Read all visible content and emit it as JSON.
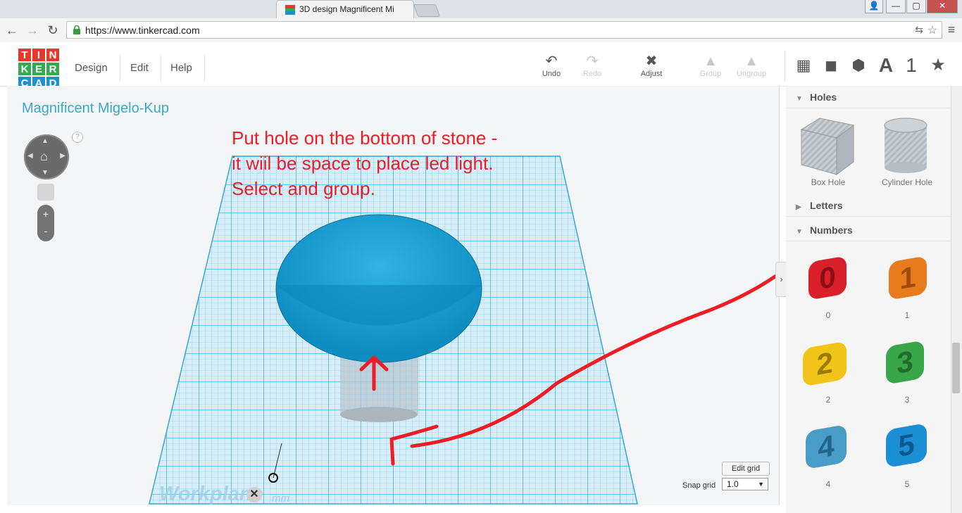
{
  "browser": {
    "tab_title": "3D design Magnificent Mi",
    "url": "https://www.tinkercad.com",
    "window_controls": {
      "user": "👤",
      "minimize": "—",
      "maximize": "▢",
      "close": "✕"
    }
  },
  "app": {
    "logo_letters": [
      "T",
      "I",
      "N",
      "K",
      "E",
      "R",
      "C",
      "A",
      "D"
    ],
    "logo_colors": [
      "#e8382e",
      "#e8382e",
      "#e8382e",
      "#35a853",
      "#35a853",
      "#35a853",
      "#1e8fcf",
      "#1e8fcf",
      "#1e8fcf"
    ],
    "menu": [
      "Design",
      "Edit",
      "Help"
    ],
    "tools": {
      "undo": "Undo",
      "redo": "Redo",
      "adjust": "Adjust",
      "group": "Group",
      "ungroup": "Ungroup"
    },
    "side_tools": {
      "letters_tab": "A",
      "numbers_tab": "1",
      "favorites_tab": "★"
    }
  },
  "canvas": {
    "design_title": "Magnificent Migelo-Kup",
    "help_mark": "?",
    "zoom_in": "+",
    "zoom_out": "-",
    "annotation": "Put hole on the bottom of stone -\nit wiil be space to place led light.\nSelect and group.",
    "edit_grid": "Edit grid",
    "snap_grid_label": "Snap grid",
    "snap_grid_value": "1.0",
    "workplane_label": "Workplane",
    "unit_label": "mm",
    "accent_color": "#1e9fd3",
    "annotation_color": "#ee1c25"
  },
  "side_panel": {
    "sections": {
      "holes": "Holes",
      "letters": "Letters",
      "numbers": "Numbers"
    },
    "holes_shapes": [
      "Box Hole",
      "Cylinder Hole"
    ],
    "number_shapes": [
      "0",
      "1",
      "2",
      "3",
      "4",
      "5"
    ],
    "number_colors": [
      "#d9202a",
      "#e87b1e",
      "#f0c419",
      "#3aa64a",
      "#4a9cc8",
      "#1a8fd6"
    ]
  }
}
